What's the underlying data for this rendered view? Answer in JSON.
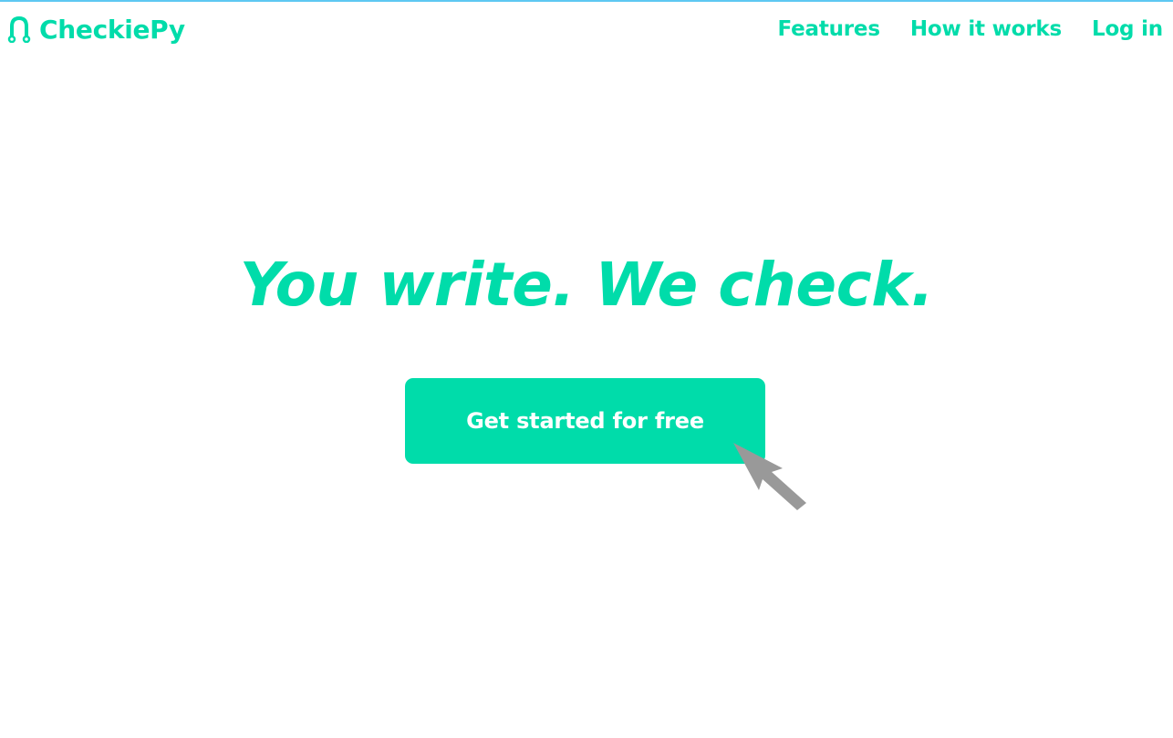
{
  "brand": {
    "name": "CheckiePy",
    "accent_color": "#00dcaa",
    "topline_color": "#5ec8f2",
    "logo_icon": "magnet-icon"
  },
  "nav": {
    "links": [
      {
        "label": "Features"
      },
      {
        "label": "How it works"
      },
      {
        "label": "Log in"
      }
    ]
  },
  "hero": {
    "headline": "You write. We check.",
    "cta_label": "Get started for free"
  },
  "cursor": {
    "icon": "arrow-pointer-icon"
  }
}
